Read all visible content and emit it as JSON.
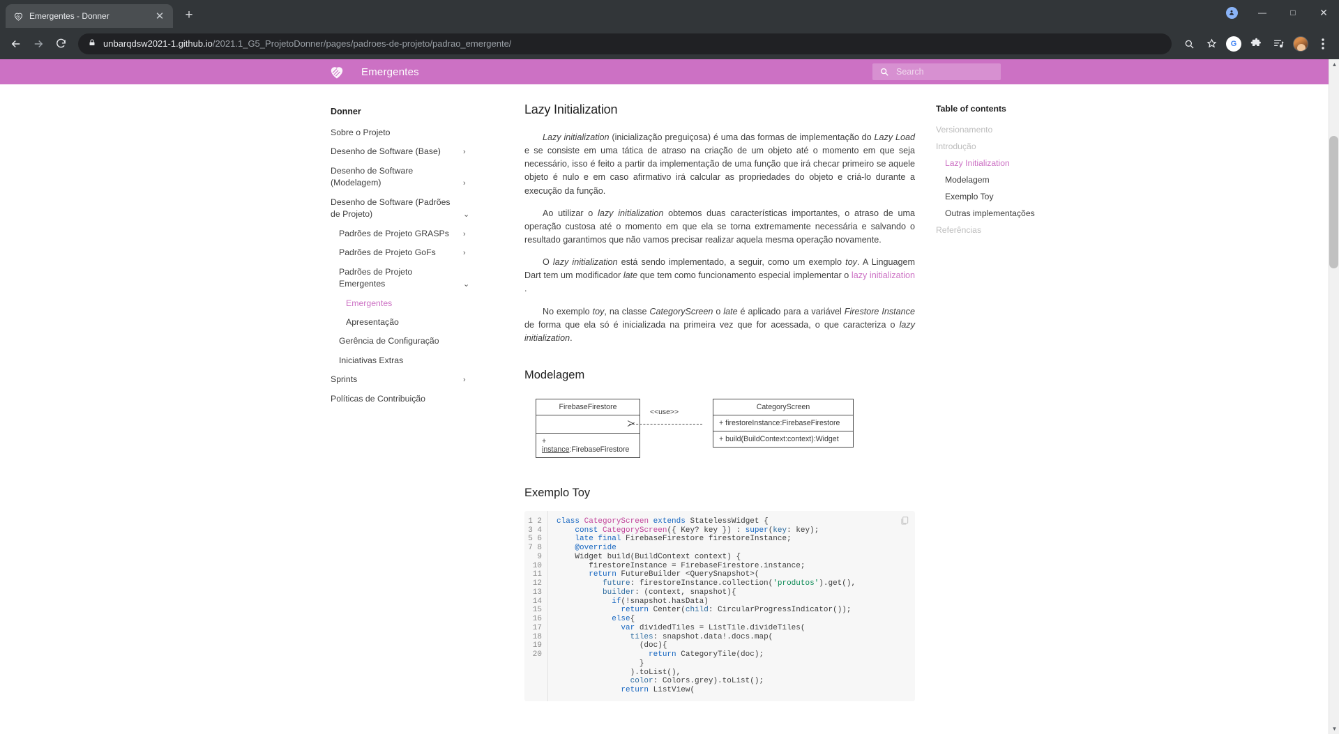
{
  "browser": {
    "tab": {
      "title": "Emergentes - Donner",
      "favicon_icon": "donner-logo-icon",
      "close_icon": "close-icon"
    },
    "new_tab_icon": "plus-icon",
    "window_controls": {
      "minimize": "minimize-icon",
      "maximize": "maximize-icon",
      "close": "window-close-icon",
      "profile_badge": "user-badge-icon"
    },
    "nav": {
      "back_icon": "arrow-back-icon",
      "forward_icon": "arrow-forward-icon",
      "reload_icon": "reload-icon"
    },
    "omnibox": {
      "lock_icon": "lock-icon",
      "url_domain": "unbarqdsw2021-1.github.io",
      "url_path": "/2021.1_G5_ProjetoDonner/pages/padroes-de-projeto/padrao_emergente/"
    },
    "toolbar_icons": [
      "search-icon",
      "bookmark-star-icon",
      "google-translate-icon",
      "extensions-puzzle-icon",
      "reading-list-icon",
      "avatar",
      "kebab-menu-icon"
    ]
  },
  "site": {
    "logo_icon": "donner-heart-logo-icon",
    "title": "Emergentes",
    "search": {
      "icon": "search-icon",
      "placeholder": "Search"
    },
    "accent_color": "#cc71c4"
  },
  "sidebar": {
    "brand": "Donner",
    "items": [
      {
        "label": "Sobre o Projeto",
        "level": 1,
        "chevron": "",
        "active": false
      },
      {
        "label": "Desenho de Software (Base)",
        "level": 1,
        "chevron": "›",
        "active": false
      },
      {
        "label": "Desenho de Software (Modelagem)",
        "level": 1,
        "chevron": "›",
        "active": false
      },
      {
        "label": "Desenho de Software (Padrões de Projeto)",
        "level": 1,
        "chevron": "⌄",
        "active": false
      },
      {
        "label": "Padrões de Projeto GRASPs",
        "level": 2,
        "chevron": "›",
        "active": false
      },
      {
        "label": "Padrões de Projeto GoFs",
        "level": 2,
        "chevron": "›",
        "active": false
      },
      {
        "label": "Padrões de Projeto Emergentes",
        "level": 2,
        "chevron": "⌄",
        "active": false
      },
      {
        "label": "Emergentes",
        "level": 3,
        "chevron": "",
        "active": true
      },
      {
        "label": "Apresentação",
        "level": 3,
        "chevron": "",
        "active": false
      },
      {
        "label": "Gerência de Configuração",
        "level": 2,
        "chevron": "",
        "active": false
      },
      {
        "label": "Iniciativas Extras",
        "level": 2,
        "chevron": "",
        "active": false
      },
      {
        "label": "Sprints",
        "level": 1,
        "chevron": "›",
        "active": false
      },
      {
        "label": "Políticas de Contribuição",
        "level": 1,
        "chevron": "",
        "active": false
      }
    ]
  },
  "toc": {
    "title": "Table of contents",
    "items": [
      {
        "label": "Versionamento",
        "level": 1,
        "active": false
      },
      {
        "label": "Introdução",
        "level": 1,
        "active": false
      },
      {
        "label": "Lazy Initialization",
        "level": 2,
        "active": true
      },
      {
        "label": "Modelagem",
        "level": 2,
        "active": false
      },
      {
        "label": "Exemplo Toy",
        "level": 2,
        "active": false
      },
      {
        "label": "Outras implementações",
        "level": 2,
        "active": false
      },
      {
        "label": "Referências",
        "level": 1,
        "active": false
      }
    ]
  },
  "content": {
    "h_lazy": "Lazy Initialization",
    "h_modelagem": "Modelagem",
    "h_exemplo": "Exemplo Toy",
    "p1_a": "Lazy initialization",
    "p1_b": " (inicialização preguiçosa) é uma das formas de implementação do ",
    "p1_c": "Lazy Load",
    "p1_d": " e se consiste em uma tática de atraso na criação de um objeto até o momento em que seja necessário, isso é feito a partir da implementação de uma função que irá checar primeiro se aquele objeto é nulo e em caso afirmativo irá calcular as propriedades do objeto e criá-lo durante a execução da função.",
    "p2_a": "Ao utilizar o ",
    "p2_b": "lazy initialization",
    "p2_c": " obtemos duas características importantes, o atraso de uma operação custosa até o momento em que ela se torna extremamente necessária e salvando o resultado garantimos que não vamos precisar realizar aquela mesma operação novamente.",
    "p3_a": "O ",
    "p3_b": "lazy initialization",
    "p3_c": " está sendo implementado, a seguir, como um exemplo ",
    "p3_d": "toy",
    "p3_e": ". A Linguagem Dart tem um modificador ",
    "p3_f": "late",
    "p3_g": " que tem como funcionamento especial implementar o ",
    "p3_link": "lazy initialization",
    "p3_h": " .",
    "p4_a": "No exemplo ",
    "p4_b": "toy",
    "p4_c": ", na classe ",
    "p4_d": "CategoryScreen",
    "p4_e": " o ",
    "p4_f": "late",
    "p4_g": " é aplicado para a variável ",
    "p4_h": "Firestore Instance",
    "p4_i": " de forma que ela só é inicializada na primeira vez que for acessada, o que caracteriza o ",
    "p4_j": "lazy initialization",
    "p4_k": "."
  },
  "uml": {
    "left_class": "FirebaseFirestore",
    "left_attr": "",
    "left_method_prefix": "+ ",
    "left_method_under": "instance",
    "left_method_rest": ":FirebaseFirestore",
    "right_class": "CategoryScreen",
    "right_attr": "+ firestoreInstance:FirebaseFirestore",
    "right_method": "+ build(BuildContext:context):Widget",
    "relation_label": "<<use>>"
  },
  "code": {
    "copy_icon": "copy-icon",
    "line_numbers": [
      "1",
      "2",
      "3",
      "4",
      "5",
      "6",
      "7",
      "8",
      "9",
      "10",
      "11",
      "12",
      "13",
      "14",
      "15",
      "16",
      "17",
      "18",
      "19",
      "20"
    ],
    "lines": [
      "class CategoryScreen extends StatelessWidget {",
      "    const CategoryScreen({ Key? key }) : super(key: key);",
      "    late final FirebaseFirestore firestoreInstance;",
      "    @override",
      "    Widget build(BuildContext context) {",
      "       firestoreInstance = FirebaseFirestore.instance;",
      "       return FutureBuilder <QuerySnapshot>(",
      "          future: firestoreInstance.collection('produtos').get(),",
      "          builder: (context, snapshot){",
      "            if(!snapshot.hasData)",
      "              return Center(child: CircularProgressIndicator());",
      "            else{",
      "              var dividedTiles = ListTile.divideTiles(",
      "                tiles: snapshot.data!.docs.map(",
      "                  (doc){",
      "                    return CategoryTile(doc);",
      "                  }",
      "                ).toList(),",
      "                color: Colors.grey).toList();",
      "              return ListView("
    ]
  },
  "scrollbar": {
    "up_icon": "chevron-up-icon",
    "down_icon": "chevron-down-icon"
  }
}
